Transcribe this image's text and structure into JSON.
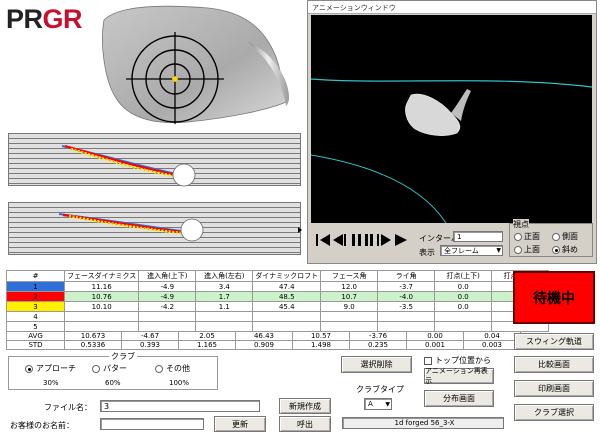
{
  "logo": {
    "left": "PR",
    "right": "GR"
  },
  "anim_window": {
    "title": "アニメーションウィンドウ",
    "interval_label": "インターバル",
    "interval_value": "1",
    "display_label": "表示",
    "display_value": "全フレーム",
    "viewpoint_label": "視点",
    "viewpoint_options": [
      "正面",
      "側面",
      "上面",
      "斜め"
    ],
    "viewpoint_selected": "斜め"
  },
  "status": {
    "label": "待機中",
    "color": "#ff0000"
  },
  "table": {
    "headers": [
      "#",
      "フェースダイナミクス",
      "進入角(上下)",
      "進入角(左右)",
      "ダイナミックロフト",
      "フェース角",
      "ライ角",
      "打点(上下)",
      "打点(左右)"
    ],
    "rows": [
      {
        "index": "1",
        "color": "#2e6fd8",
        "values": [
          "11.16",
          "-4.9",
          "3.4",
          "47.4",
          "12.0",
          "-3.7",
          "0.0",
          "0.0"
        ]
      },
      {
        "index": "2",
        "color": "#ff0000",
        "values": [
          "10.76",
          "-4.9",
          "1.7",
          "48.5",
          "10.7",
          "-4.0",
          "0.0",
          "0.0"
        ]
      },
      {
        "index": "3",
        "color": "#fff000",
        "values": [
          "10.10",
          "-4.2",
          "1.1",
          "45.4",
          "9.0",
          "-3.5",
          "0.0",
          "0.0"
        ]
      },
      {
        "index": "4",
        "color": "",
        "values": [
          "",
          "",
          "",
          "",
          "",
          "",
          "",
          ""
        ]
      },
      {
        "index": "5",
        "color": "",
        "values": [
          "",
          "",
          "",
          "",
          "",
          "",
          "",
          ""
        ]
      }
    ],
    "avg_label": "AVG",
    "avg": [
      "10.673",
      "-4.67",
      "2.05",
      "46.43",
      "10.57",
      "-3.76",
      "0.00",
      "0.04"
    ],
    "std_label": "STD",
    "std": [
      "0.5336",
      "0.393",
      "1.165",
      "0.909",
      "1.498",
      "0.235",
      "0.001",
      "0.003"
    ]
  },
  "club": {
    "legend": "クラブ",
    "options": [
      {
        "label": "アプローチ",
        "pct": "30%",
        "selected": true
      },
      {
        "label": "パター",
        "pct": "60%",
        "selected": false
      },
      {
        "label": "その他",
        "pct": "100%",
        "selected": false
      }
    ],
    "type_label": "クラブタイプ",
    "type_value": "A",
    "club_name": "1d forged 56_3-X"
  },
  "form": {
    "file_label": "ファイル名：",
    "file_value": "3",
    "customer_label": "お客様のお名前：",
    "customer_value": ""
  },
  "buttons": {
    "new": "新規作成",
    "update": "更新",
    "call": "呼出",
    "delete": "選択削除",
    "top_pos": "トップ位置から",
    "replay": "アニメーション再表示",
    "distribution": "分布画面",
    "swing": "スウィング軌道",
    "compare": "比較画面",
    "print": "印刷画面",
    "club_select": "クラブ選択"
  }
}
